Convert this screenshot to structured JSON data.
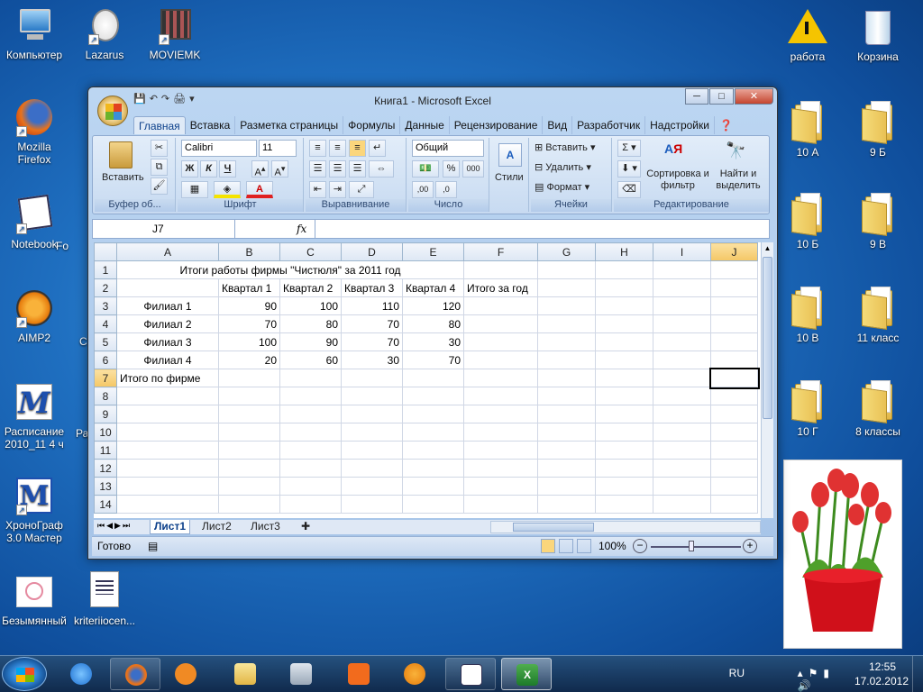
{
  "desktop": {
    "left_icons": [
      {
        "label": "Компьютер"
      },
      {
        "label": "Lazarus"
      },
      {
        "label": "MOVIEMK"
      },
      {
        "label": "Mozilla Firefox"
      },
      {
        "label": "Notebook"
      },
      {
        "label": "Fo"
      },
      {
        "label": "AIMP2"
      },
      {
        "label": "C"
      },
      {
        "label": "Расписание 2010_11 4 ч"
      },
      {
        "label": "Ра"
      },
      {
        "label": "ХроноГраф 3.0 Мастер"
      },
      {
        "label": "Безымянный"
      },
      {
        "label": "kriteriiocen..."
      }
    ],
    "right_icons": [
      {
        "label": "работа"
      },
      {
        "label": "Корзина"
      },
      {
        "label": "10 А"
      },
      {
        "label": "9 Б"
      },
      {
        "label": "10 Б"
      },
      {
        "label": "9 В"
      },
      {
        "label": "10 В"
      },
      {
        "label": "11 класс"
      },
      {
        "label": "10 Г"
      },
      {
        "label": "8 классы"
      }
    ]
  },
  "excel": {
    "title": "Книга1 - Microsoft Excel",
    "tabs": [
      "Главная",
      "Вставка",
      "Разметка страницы",
      "Формулы",
      "Данные",
      "Рецензирование",
      "Вид",
      "Разработчик",
      "Надстройки"
    ],
    "groups": {
      "clipboard": {
        "label": "Буфер об...",
        "paste": "Вставить"
      },
      "font": {
        "label": "Шрифт",
        "name": "Calibri",
        "size": "11",
        "bold": "Ж",
        "italic": "К",
        "underline": "Ч"
      },
      "align": {
        "label": "Выравнивание"
      },
      "number": {
        "label": "Число",
        "format": "Общий"
      },
      "styles": {
        "label": "Стили"
      },
      "cells": {
        "label": "Ячейки",
        "insert": "Вставить",
        "delete": "Удалить",
        "format": "Формат"
      },
      "editing": {
        "label": "Редактирование",
        "sort": "Сортировка и фильтр",
        "find": "Найти и выделить"
      }
    },
    "name_box": "J7",
    "fx": "fx",
    "columns": [
      "A",
      "B",
      "C",
      "D",
      "E",
      "F",
      "G",
      "H",
      "I",
      "J"
    ],
    "rows": [
      [
        "1",
        "",
        "",
        "",
        "",
        "",
        "",
        "",
        "",
        "",
        ""
      ],
      [
        "2",
        "",
        "Квартал 1",
        "Квартал 2",
        "Квартал 3",
        "Квартал 4",
        "Итого за год",
        "",
        "",
        "",
        ""
      ],
      [
        "3",
        "Филиал 1",
        "90",
        "100",
        "110",
        "120",
        "",
        "",
        "",
        "",
        ""
      ],
      [
        "4",
        "Филиал 2",
        "70",
        "80",
        "70",
        "80",
        "",
        "",
        "",
        "",
        ""
      ],
      [
        "5",
        "Филиал 3",
        "100",
        "90",
        "70",
        "30",
        "",
        "",
        "",
        "",
        ""
      ],
      [
        "6",
        "Филиал 4",
        "20",
        "60",
        "30",
        "70",
        "",
        "",
        "",
        "",
        ""
      ],
      [
        "7",
        "Итого по фирме",
        "",
        "",
        "",
        "",
        "",
        "",
        "",
        "",
        ""
      ],
      [
        "8",
        "",
        "",
        "",
        "",
        "",
        "",
        "",
        "",
        "",
        ""
      ],
      [
        "9",
        "",
        "",
        "",
        "",
        "",
        "",
        "",
        "",
        "",
        ""
      ],
      [
        "10",
        "",
        "",
        "",
        "",
        "",
        "",
        "",
        "",
        "",
        ""
      ],
      [
        "11",
        "",
        "",
        "",
        "",
        "",
        "",
        "",
        "",
        "",
        ""
      ],
      [
        "12",
        "",
        "",
        "",
        "",
        "",
        "",
        "",
        "",
        "",
        ""
      ],
      [
        "13",
        "",
        "",
        "",
        "",
        "",
        "",
        "",
        "",
        "",
        ""
      ],
      [
        "14",
        "",
        "",
        "",
        "",
        "",
        "",
        "",
        "",
        "",
        ""
      ]
    ],
    "merged_title": "Итоги работы фирмы \"Чистюля\" за 2011 год",
    "sheets": [
      "Лист1",
      "Лист2",
      "Лист3"
    ],
    "status": "Готово",
    "zoom": "100%"
  },
  "tray": {
    "lang": "RU",
    "time": "12:55",
    "date": "17.02.2012"
  }
}
